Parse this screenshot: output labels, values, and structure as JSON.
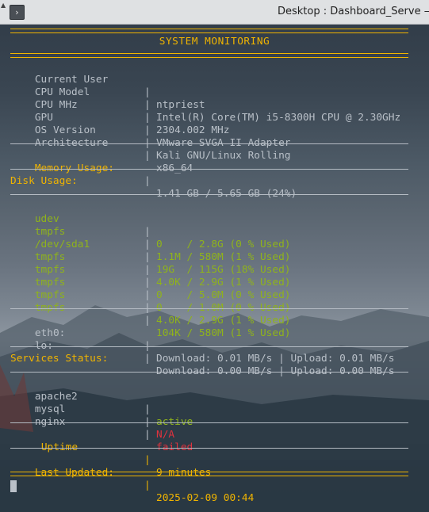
{
  "window": {
    "title": "Desktop : Dashboard_Serve — K",
    "menu_glyph": "›",
    "pin_glyph": "▲"
  },
  "dashboard": {
    "header": "SYSTEM MONITORING",
    "separator": "|",
    "system_info": [
      {
        "label": "Current User",
        "value": "ntpriest"
      },
      {
        "label": "CPU Model",
        "value": "Intel(R) Core(TM) i5-8300H CPU @ 2.30GHz"
      },
      {
        "label": "CPU MHz",
        "value": "2304.002 MHz"
      },
      {
        "label": "GPU",
        "value": "VMware SVGA II Adapter"
      },
      {
        "label": "OS Version",
        "value": "Kali GNU/Linux Rolling"
      },
      {
        "label": "Architecture",
        "value": "x86_64"
      }
    ],
    "memory": {
      "label": "Memory Usage:",
      "value": "1.41 GB / 5.65 GB (24%)"
    },
    "disk": {
      "label": "Disk Usage:",
      "rows": [
        {
          "name": "udev",
          "usage": "0    / 2.8G (0 % Used)"
        },
        {
          "name": "tmpfs",
          "usage": "1.1M / 580M (1 % Used)"
        },
        {
          "name": "/dev/sda1",
          "usage": "19G  / 115G (18% Used)"
        },
        {
          "name": "tmpfs",
          "usage": "4.0K / 2.9G (1 % Used)"
        },
        {
          "name": "tmpfs",
          "usage": "0    / 5.0M (0 % Used)"
        },
        {
          "name": "tmpfs",
          "usage": "0    / 1.0M (0 % Used)"
        },
        {
          "name": "tmpfs",
          "usage": "4.0K / 2.9G (1 % Used)"
        },
        {
          "name": "tmpfs",
          "usage": "104K / 580M (1 % Used)"
        }
      ]
    },
    "network": [
      {
        "iface": "eth0:",
        "stats": "Download: 0.01 MB/s | Upload: 0.01 MB/s"
      },
      {
        "iface": "lo:",
        "stats": "Download: 0.00 MB/s | Upload: 0.00 MB/s"
      }
    ],
    "services": {
      "label": "Services Status:",
      "rows": [
        {
          "name": "apache2",
          "status": "active"
        },
        {
          "name": "mysql",
          "status": "N/A"
        },
        {
          "name": "nginx",
          "status": "failed"
        }
      ]
    },
    "uptime": {
      "label": "Uptime",
      "value": "9 minutes"
    },
    "last_updated": {
      "label": "Last Updated:",
      "value": "2025-02-09 00:44"
    }
  },
  "colors": {
    "accent": "#f0b400",
    "text": "#b9c0c8",
    "ok": "#8fb31b",
    "error": "#e0323e"
  }
}
